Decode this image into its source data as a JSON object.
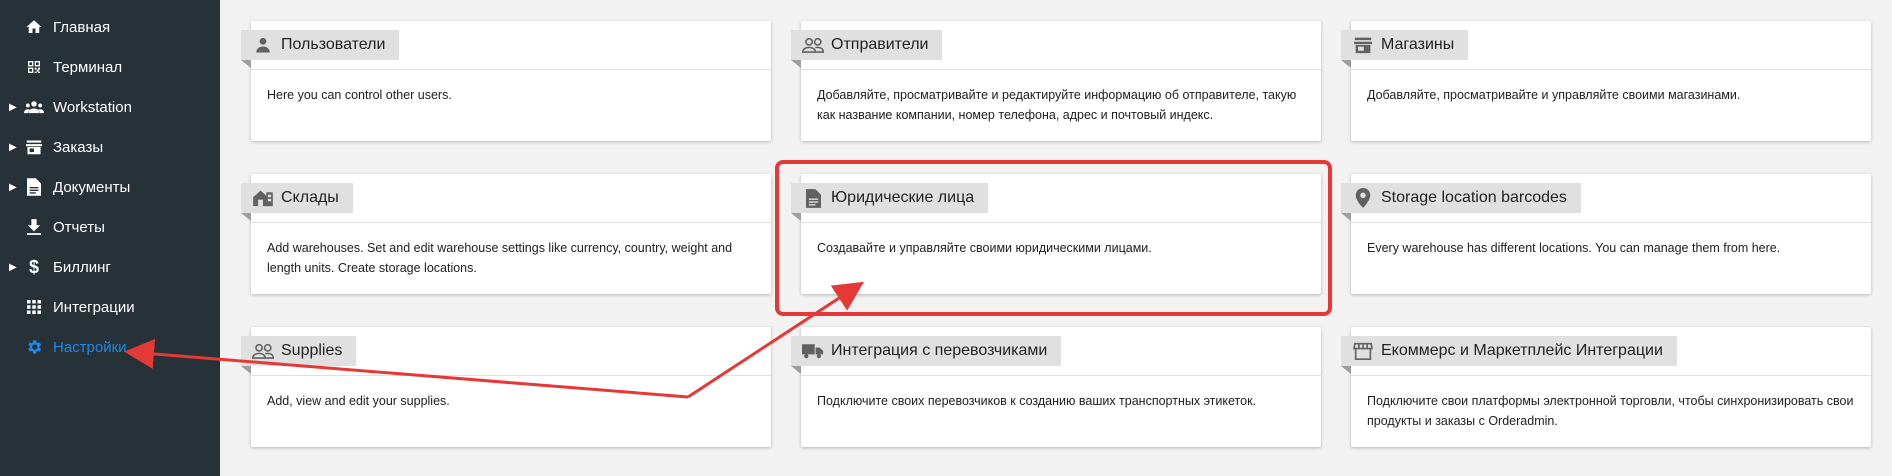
{
  "sidebar": {
    "items": [
      {
        "label": "Главная",
        "icon": "home-icon",
        "expandable": false
      },
      {
        "label": "Терминал",
        "icon": "qr-code-icon",
        "expandable": false
      },
      {
        "label": "Workstation",
        "icon": "group-icon",
        "expandable": true
      },
      {
        "label": "Заказы",
        "icon": "store-icon",
        "expandable": true
      },
      {
        "label": "Документы",
        "icon": "document-icon",
        "expandable": true
      },
      {
        "label": "Отчеты",
        "icon": "download-icon",
        "expandable": false
      },
      {
        "label": "Биллинг",
        "icon": "dollar-icon",
        "expandable": true
      },
      {
        "label": "Интеграции",
        "icon": "apps-grid-icon",
        "expandable": false
      },
      {
        "label": "Настройки",
        "icon": "gear-icon",
        "expandable": false,
        "active": true
      }
    ]
  },
  "cards": [
    {
      "title": "Пользователи",
      "icon": "person-icon",
      "description": "Here you can control other users."
    },
    {
      "title": "Отправители",
      "icon": "people-outline-icon",
      "description": "Добавляйте, просматривайте и редактируйте информацию об отправителе, такую как название компании, номер телефона, адрес и почтовый индекс."
    },
    {
      "title": "Магазины",
      "icon": "store-icon",
      "description": "Добавляйте, просматривайте и управляйте своими магазинами."
    },
    {
      "title": "Склады",
      "icon": "warehouse-icon",
      "description": "Add warehouses. Set and edit warehouse settings like currency, country, weight and length units. Create storage locations."
    },
    {
      "title": "Юридические лица",
      "icon": "document-icon",
      "description": "Создавайте и управляйте своими юридическими лицами."
    },
    {
      "title": "Storage location barcodes",
      "icon": "location-pin-icon",
      "description": "Every warehouse has different locations. You can manage them from here."
    },
    {
      "title": "Supplies",
      "icon": "people-outline-icon",
      "description": "Add, view and edit your supplies."
    },
    {
      "title": "Интеграция с перевозчиками",
      "icon": "truck-icon",
      "description": "Подключите своих перевозчиков к созданию ваших транспортных этикеток."
    },
    {
      "title": "Екоммерс и Маркетплейс Интеграции",
      "icon": "storefront-icon",
      "description": "Подключите свои платформы электронной торговли, чтобы синхронизировать свои продукты и заказы с Orderadmin."
    }
  ],
  "colors": {
    "sidebar_bg": "#263238",
    "active": "#1e88e5",
    "annotation": "#e53935",
    "tab_bg": "#e0e0e0"
  }
}
